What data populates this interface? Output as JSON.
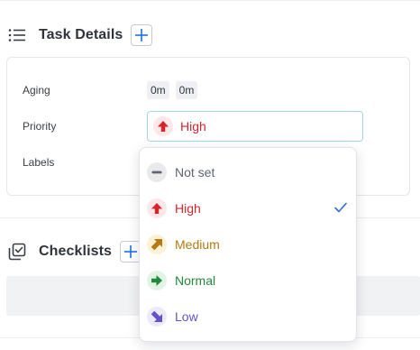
{
  "task_details": {
    "title": "Task Details",
    "aging": {
      "label": "Aging",
      "values": [
        "0m",
        "0m"
      ]
    },
    "priority": {
      "label": "Priority",
      "value": "High"
    },
    "labels": {
      "label": "Labels"
    }
  },
  "checklists": {
    "title": "Checklists"
  },
  "priority_dropdown": {
    "selected": "High",
    "options": [
      {
        "label": "Not set",
        "color": "#5f6570",
        "bg": "#e9eaec",
        "icon": "minus-icon"
      },
      {
        "label": "High",
        "color": "#d8232a",
        "bg": "#fde7e8",
        "icon": "arrow-up-icon"
      },
      {
        "label": "Medium",
        "color": "#b57a12",
        "bg": "#fdf1d6",
        "icon": "arrow-up-right-icon"
      },
      {
        "label": "Normal",
        "color": "#23893b",
        "bg": "#e2f4e6",
        "icon": "arrow-right-icon"
      },
      {
        "label": "Low",
        "color": "#6651c8",
        "bg": "#ece9fb",
        "icon": "arrow-down-right-icon"
      }
    ]
  }
}
